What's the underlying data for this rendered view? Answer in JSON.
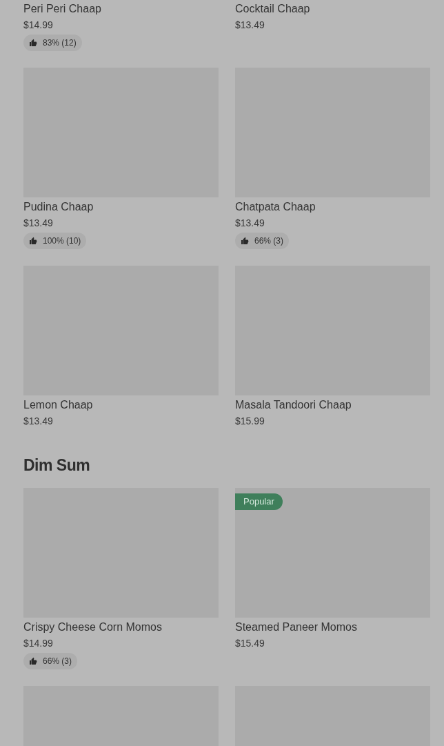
{
  "sections": [
    {
      "items": [
        {
          "kind": "text",
          "name": "Peri Peri Chaap",
          "price": "$14.99",
          "rating": "83% (12)"
        },
        {
          "kind": "text",
          "name": "Cocktail Chaap",
          "price": "$13.49"
        },
        {
          "kind": "dish",
          "name": "Pudina Chaap",
          "price": "$13.49",
          "rating": "100% (10)"
        },
        {
          "kind": "dish",
          "name": "Chatpata Chaap",
          "price": "$13.49",
          "rating": "66% (3)"
        },
        {
          "kind": "dish",
          "name": "Lemon Chaap",
          "price": "$13.49"
        },
        {
          "kind": "dish",
          "name": "Masala Tandoori Chaap",
          "price": "$15.99"
        }
      ]
    },
    {
      "title": "Dim Sum",
      "items": [
        {
          "kind": "dish",
          "name": "Crispy Cheese Corn Momos",
          "price": "$14.99",
          "rating": "66% (3)"
        },
        {
          "kind": "dish",
          "name": "Steamed Paneer Momos",
          "price": "$15.49",
          "badge": "Popular"
        },
        {
          "kind": "image"
        },
        {
          "kind": "image"
        }
      ]
    }
  ]
}
